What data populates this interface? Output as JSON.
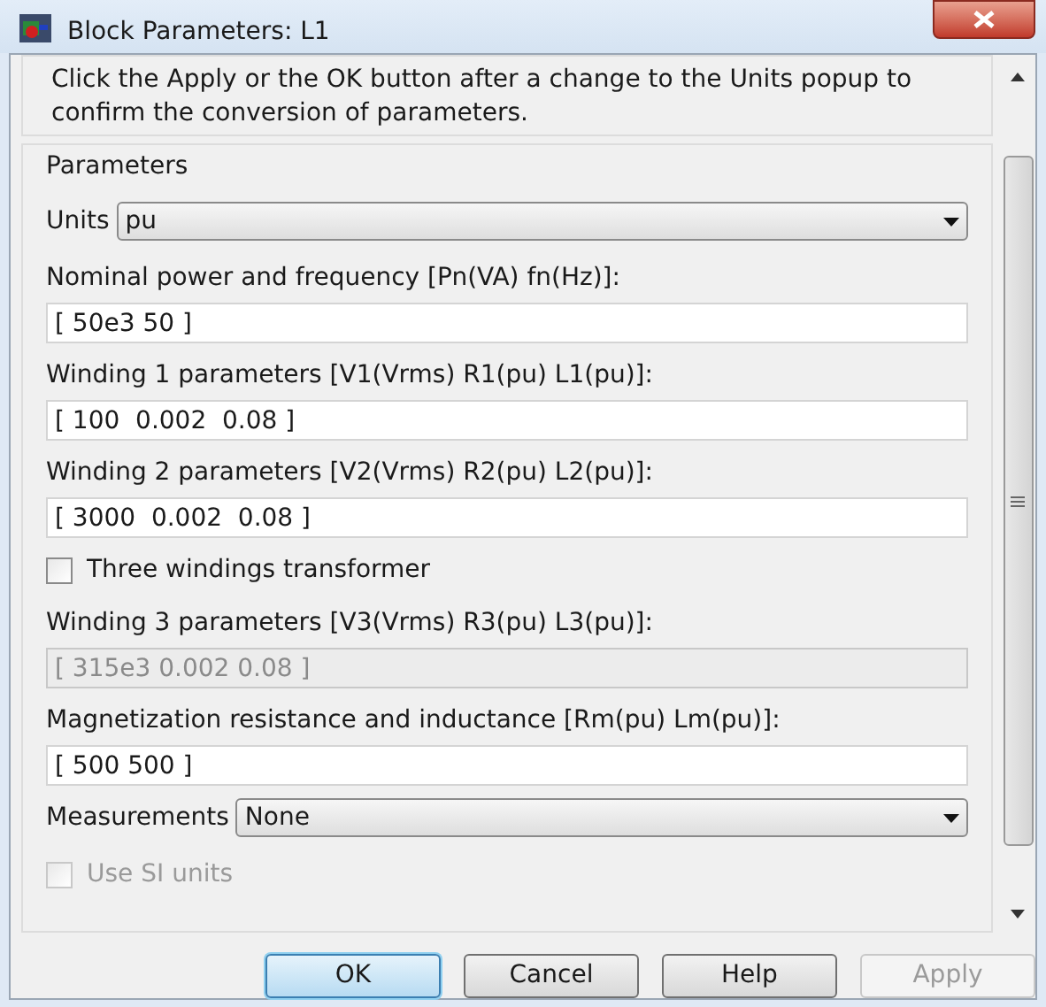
{
  "window": {
    "title": "Block Parameters: L1"
  },
  "info": "Click the Apply or the OK button after a change to the Units popup to confirm the conversion of parameters.",
  "group_title": "Parameters",
  "rows": [
    {
      "kind": "dropdown",
      "label": "Units",
      "value": "pu"
    },
    {
      "kind": "field",
      "label": "Nominal power and frequency [Pn(VA) fn(Hz)]:",
      "value": "[ 50e3 50 ]",
      "disabled": false
    },
    {
      "kind": "field",
      "label": "Winding 1 parameters [V1(Vrms) R1(pu) L1(pu)]:",
      "value": "[ 100  0.002  0.08 ]",
      "disabled": false
    },
    {
      "kind": "field",
      "label": "Winding 2 parameters [V2(Vrms) R2(pu) L2(pu)]:",
      "value": "[ 3000  0.002  0.08 ]",
      "disabled": false
    },
    {
      "kind": "checkbox",
      "label": "Three windings transformer",
      "checked": false,
      "disabled": false
    },
    {
      "kind": "field",
      "label": "Winding 3 parameters [V3(Vrms) R3(pu) L3(pu)]:",
      "value": "[ 315e3 0.002 0.08 ]",
      "disabled": true
    },
    {
      "kind": "field",
      "label": "Magnetization resistance and inductance [Rm(pu) Lm(pu)]:",
      "value": "[ 500 500 ]",
      "disabled": false
    },
    {
      "kind": "dropdown",
      "label": "Measurements",
      "value": "None"
    },
    {
      "kind": "checkbox",
      "label": "Use SI units",
      "checked": false,
      "disabled": true
    }
  ],
  "buttons": [
    {
      "label": "OK",
      "selected": true,
      "disabled": false
    },
    {
      "label": "Cancel",
      "selected": false,
      "disabled": false
    },
    {
      "label": "Help",
      "selected": false,
      "disabled": false
    },
    {
      "label": "Apply",
      "selected": false,
      "disabled": true
    }
  ]
}
